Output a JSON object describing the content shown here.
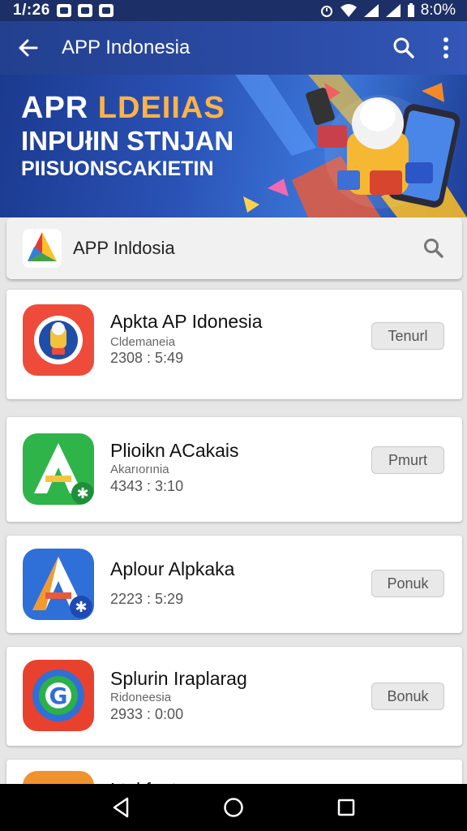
{
  "status_bar": {
    "time": "1/:26",
    "battery": "8:0%"
  },
  "app_bar": {
    "title": "APP Indonesia"
  },
  "banner": {
    "line1_a": "APR ",
    "line1_b": "LDEIIAS",
    "line2": "INPUłIN STNJAN",
    "line3": "PIISUONSCAKIETIN"
  },
  "search": {
    "text": "APP Inldosia"
  },
  "apps": [
    {
      "name": "Apkta AP Idonesia",
      "sub": "Cldemaneia",
      "stamp": "2308 : 5:49",
      "action": "Tenurl"
    },
    {
      "name": "Plioikn ACakais",
      "sub": "Akarıorınia",
      "stamp": "4343 : 3:10",
      "action": "Pmurt"
    },
    {
      "name": "Aplour Alpkaka",
      "sub": "",
      "stamp": "2223 : 5:29",
      "action": "Ponuk"
    },
    {
      "name": "Splurin Iraplarag",
      "sub": "Ridoneesia",
      "stamp": "2933 : 0:00",
      "action": "Bonuk"
    },
    {
      "name": "Ltul fnnt",
      "sub": "",
      "stamp": "",
      "action": ""
    }
  ],
  "colors": {
    "app_bar": "#23408f",
    "status_bar": "#1c2f66",
    "accent": "#3257b8"
  }
}
